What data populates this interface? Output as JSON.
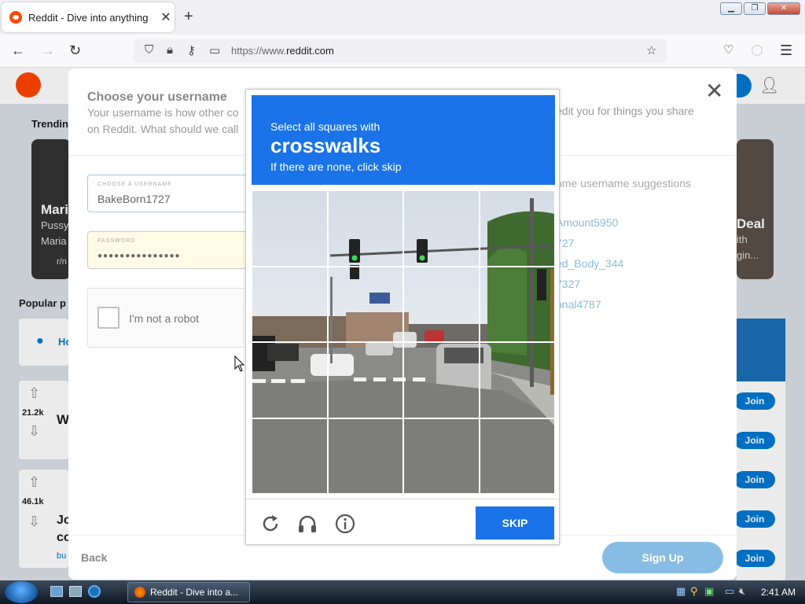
{
  "browser": {
    "tab_title": "Reddit - Dive into anything",
    "url_prefix": "https://www.",
    "url_domain": "reddit.com"
  },
  "background": {
    "trending_label": "Trendin",
    "popular_label": "Popular p",
    "card_left_title": "Mari",
    "card_left_line1": "Pussy",
    "card_left_line2": "Maria",
    "card_left_sub": "r/n",
    "card_right_title": "Deal",
    "card_right_line1": "ith",
    "card_right_line2": "gin...",
    "post1_votes": "21.2k",
    "post1_text": "W",
    "post2_votes": "46.1k",
    "post2_text_a": "Jo",
    "post2_text_b": "co",
    "post2_sub": "bu",
    "home_text": "Ho",
    "join_label": "Join"
  },
  "modal": {
    "title": "Choose your username",
    "subtitle": "Your username is how other co on Reddit. What should we call",
    "subtitle_right": "edit you for things you share",
    "username_label": "CHOOSE A USERNAME",
    "username_value": "BakeBorn1727",
    "password_label": "PASSWORD",
    "password_value": "●●●●●●●●●●●●●●●",
    "recaptcha_label": "I'm not a robot",
    "suggestions_heading": "ome username suggestions",
    "suggestions": [
      "Amount5950",
      "727",
      "ed_Body_344",
      "7327",
      "onal4787"
    ],
    "back_label": "Back",
    "signup_label": "Sign Up"
  },
  "captcha": {
    "line1": "Select all squares with",
    "keyword": "crosswalks",
    "line3": "If there are none, click skip",
    "skip_label": "SKIP"
  },
  "taskbar": {
    "task_label": "Reddit - Dive into a...",
    "clock": "2:41 AM"
  },
  "colors": {
    "captcha_blue": "#1a73e8",
    "reddit_orange": "#ff4500",
    "reddit_blue": "#0079d3"
  }
}
